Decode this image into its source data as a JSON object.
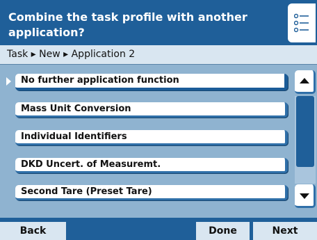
{
  "header": {
    "title_line1": "Combine the task profile with another",
    "title_line2": "application?",
    "menu_icon": "list-options-icon"
  },
  "breadcrumb": {
    "text": "Task ▸ New ▸ Application 2"
  },
  "options": [
    {
      "label": "No further application function",
      "selected": true
    },
    {
      "label": "Mass Unit Conversion",
      "selected": false
    },
    {
      "label": "Individual Identifiers",
      "selected": false
    },
    {
      "label": "DKD Uncert. of Measuremt.",
      "selected": false
    },
    {
      "label": "Second Tare (Preset Tare)",
      "selected": false
    }
  ],
  "scrollbar": {
    "up_icon": "scroll-up-arrow-icon",
    "down_icon": "scroll-down-arrow-icon"
  },
  "footer": {
    "back_label": "Back",
    "done_label": "Done",
    "next_label": "Next"
  },
  "colors": {
    "header_bg": "#1f5f99",
    "page_bg": "#8fb3d0",
    "breadcrumb_bg": "#d9e6f1",
    "button_border": "#2f6fa8"
  }
}
